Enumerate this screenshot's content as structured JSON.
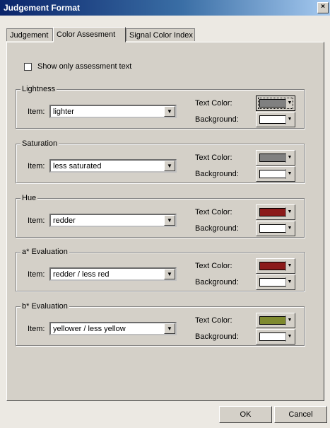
{
  "window": {
    "title": "Judgement Format",
    "close_label": "×"
  },
  "tabs": [
    {
      "label": "Judgement"
    },
    {
      "label": "Color Assesment"
    },
    {
      "label": "Signal Color Index"
    }
  ],
  "show_only_assessment_text": {
    "label": "Show only assessment text",
    "checked": false
  },
  "labels": {
    "item": "Item:",
    "text_color": "Text Color:",
    "background": "Background:"
  },
  "groups": [
    {
      "title": "Lightness",
      "item": "lighter",
      "text_color": "#808080",
      "background": "#ffffff"
    },
    {
      "title": "Saturation",
      "item": "less saturated",
      "text_color": "#808080",
      "background": "#ffffff"
    },
    {
      "title": "Hue",
      "item": "redder",
      "text_color": "#8b1a1a",
      "background": "#ffffff"
    },
    {
      "title": "a* Evaluation",
      "item": "redder / less red",
      "text_color": "#8b1a1a",
      "background": "#ffffff"
    },
    {
      "title": "b* Evaluation",
      "item": "yellower / less yellow",
      "text_color": "#7f8a2e",
      "background": "#ffffff"
    }
  ],
  "buttons": {
    "ok": "OK",
    "cancel": "Cancel"
  }
}
